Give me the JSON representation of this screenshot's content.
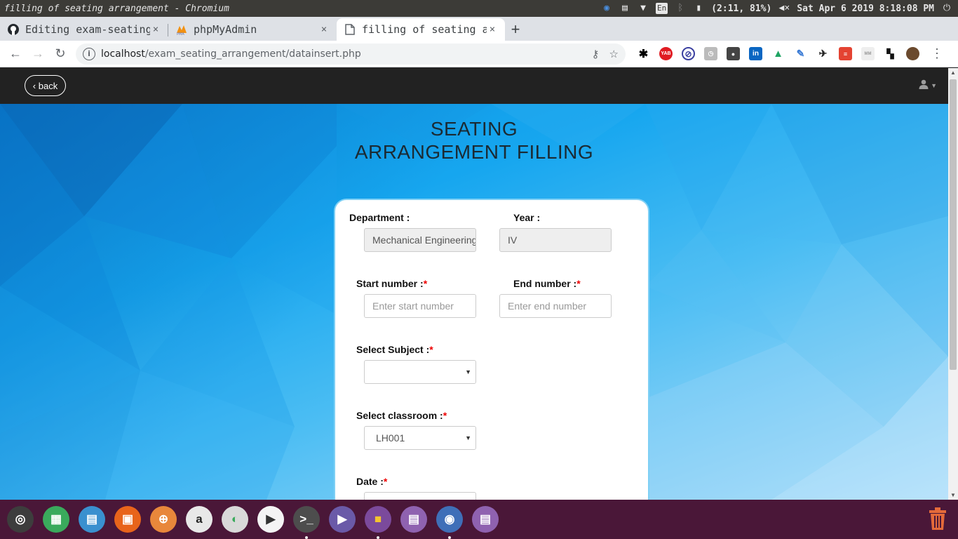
{
  "system_bar": {
    "window_title": "filling of seating arrangement - Chromium",
    "battery": "(2:11, 81%)",
    "datetime": "Sat Apr  6 2019   8:18:08 PM",
    "language": "En"
  },
  "tabs": [
    {
      "label": "Editing exam-seating",
      "icon": "github-icon",
      "close": "×"
    },
    {
      "label": "phpMyAdmin",
      "icon": "phpmyadmin-icon",
      "close": "×"
    },
    {
      "label": "filling of seating arrangement",
      "icon": "page-icon",
      "close": "×"
    }
  ],
  "new_tab_label": "+",
  "address": {
    "host": "localhost",
    "path": "/exam_seating_arrangement/datainsert.php"
  },
  "navbar": {
    "back_label": "‹ back"
  },
  "heading": {
    "line1": "SEATING",
    "line2": "ARRANGEMENT FILLING"
  },
  "form": {
    "department": {
      "label": "Department :",
      "value": "Mechanical Engineering"
    },
    "year": {
      "label": "Year :",
      "value": "IV"
    },
    "start_number": {
      "label": "Start number :",
      "required_mark": "*",
      "placeholder": "Enter start number"
    },
    "end_number": {
      "label": "End number :",
      "required_mark": "*",
      "placeholder": "Enter end number"
    },
    "subject": {
      "label": "Select Subject :",
      "required_mark": "*",
      "value": ""
    },
    "classroom": {
      "label": "Select classroom :",
      "required_mark": "*",
      "value": "LH001"
    },
    "date": {
      "label": "Date :",
      "required_mark": "*"
    }
  },
  "colors": {
    "navbar": "#222222",
    "card_border": "#7fd0f5",
    "required": "#ee0000",
    "dock": "#4a1738"
  },
  "dock_apps": [
    {
      "name": "ubuntu-icon",
      "color": "#3d3d3d"
    },
    {
      "name": "spreadsheet-icon",
      "color": "#3aaa5c"
    },
    {
      "name": "document-icon",
      "color": "#3a90cf"
    },
    {
      "name": "impress-icon",
      "color": "#e8641b"
    },
    {
      "name": "software-center-icon",
      "color": "#e8873b"
    },
    {
      "name": "amazon-icon",
      "color": "#e8e8e8"
    },
    {
      "name": "settings-toggle-icon",
      "color": "#d9d9d9"
    },
    {
      "name": "media-player-icon",
      "color": "#f4f4f4"
    },
    {
      "name": "terminal-icon",
      "color": "#4d4d4d"
    },
    {
      "name": "video-player-icon",
      "color": "#6a5aa8"
    },
    {
      "name": "files-icon",
      "color": "#7b4a9c"
    },
    {
      "name": "text-editor-icon",
      "color": "#8f62b0"
    },
    {
      "name": "chromium-icon",
      "color": "#3f6fb8"
    },
    {
      "name": "notes-icon",
      "color": "#8f62b0"
    }
  ]
}
